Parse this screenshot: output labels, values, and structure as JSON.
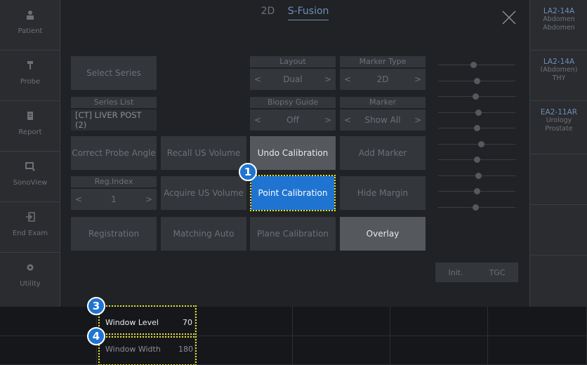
{
  "sidebar": {
    "items": [
      {
        "label": "Patient",
        "icon": "person-icon"
      },
      {
        "label": "Probe",
        "icon": "probe-icon"
      },
      {
        "label": "Report",
        "icon": "report-icon"
      },
      {
        "label": "SonoView",
        "icon": "sonoview-icon"
      },
      {
        "label": "End Exam",
        "icon": "end-exam-icon"
      },
      {
        "label": "Utility",
        "icon": "gear-icon"
      }
    ]
  },
  "tabs": [
    {
      "label": "2D",
      "active": false
    },
    {
      "label": "S-Fusion",
      "active": true
    }
  ],
  "presets": [
    {
      "probe": "LA2-14A",
      "app1": "Abdomen",
      "app2": "Abdomen"
    },
    {
      "probe": "LA2-14A",
      "app1": "(Abdomen)",
      "app2": "THY"
    },
    {
      "probe": "EA2-11AR",
      "app1": "Urology",
      "app2": "Prostate"
    }
  ],
  "controls": {
    "select_series": "Select Series",
    "series_list_label": "Series List",
    "series_list_value": "[CT] LIVER POST (2)",
    "layout_label": "Layout",
    "layout_value": "Dual",
    "marker_type_label": "Marker Type",
    "marker_type_value": "2D",
    "biopsy_guide_label": "Biopsy Guide",
    "biopsy_guide_value": "Off",
    "marker_label": "Marker",
    "marker_value": "Show All",
    "correct_probe_angle": "Correct Probe Angle",
    "recall_us_volume": "Recall US Volume",
    "undo_calibration": "Undo Calibration",
    "add_marker": "Add Marker",
    "reg_index_label": "Reg.Index",
    "reg_index_value": "1",
    "acquire_us_volume": "Acquire US Volume",
    "point_calibration": "Point Calibration",
    "hide_margin": "Hide Margin",
    "registration": "Registration",
    "matching_auto": "Matching Auto",
    "plane_calibration": "Plane Calibration",
    "overlay": "Overlay",
    "init": "Init.",
    "tgc": "TGC",
    "arrow_left": "<",
    "arrow_right": ">"
  },
  "tgc_levels": [
    0.45,
    0.5,
    0.48,
    0.52,
    0.5,
    0.55,
    0.5,
    0.52,
    0.5,
    0.48
  ],
  "knobs": {
    "window_level_label": "Window Level",
    "window_level_value": "70",
    "window_width_label": "Window Width",
    "window_width_value": "180"
  },
  "callouts": [
    "1",
    "3",
    "4"
  ],
  "colors": {
    "accent": "#1f74d1",
    "highlight": "#e3e33a"
  }
}
